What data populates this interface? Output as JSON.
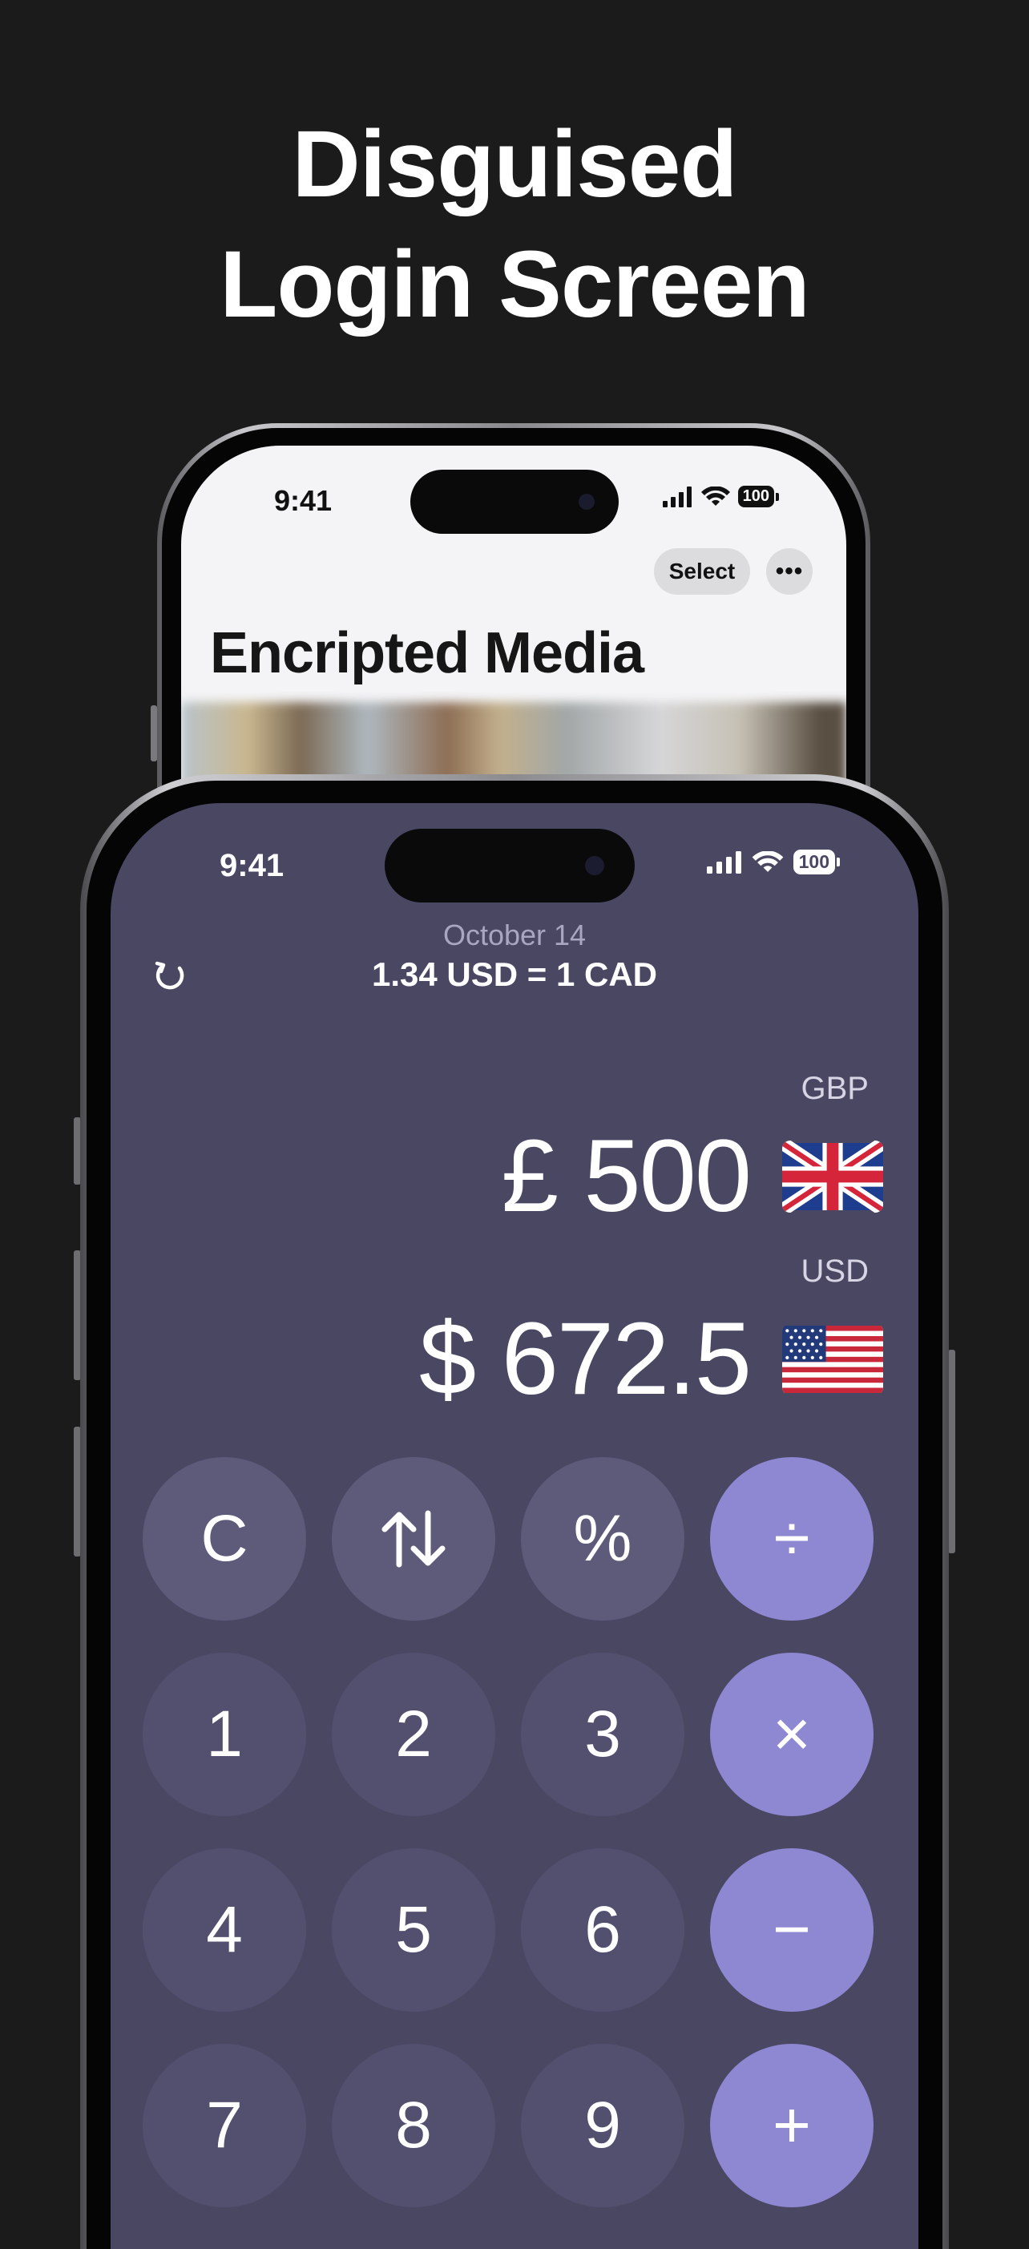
{
  "headline": {
    "line1": "Disguised",
    "line2": "Login Screen"
  },
  "back_phone": {
    "time": "9:41",
    "battery": "100",
    "select_label": "Select",
    "more_label": "•••",
    "title": "Encripted Media"
  },
  "front_phone": {
    "time": "9:41",
    "battery": "100",
    "rate": {
      "date": "October 14",
      "line": "1.34 USD = 1 CAD"
    },
    "from": {
      "code": "GBP",
      "amount": "£ 500",
      "flag": "uk-flag"
    },
    "to": {
      "code": "USD",
      "amount": "$ 672.5",
      "flag": "us-flag"
    },
    "keys": {
      "clear": "C",
      "swap_icon": "swap-arrows-icon",
      "percent": "%",
      "divide": "÷",
      "k1": "1",
      "k2": "2",
      "k3": "3",
      "multiply": "×",
      "k4": "4",
      "k5": "5",
      "k6": "6",
      "minus": "−",
      "k7": "7",
      "k8": "8",
      "k9": "9",
      "plus": "+"
    }
  },
  "colors": {
    "background": "#1b1b1c",
    "calculator_bg": "#4a4763",
    "function_key": "#5e5a7a",
    "number_key": "#534f6e",
    "operator_key": "#8e87d2"
  }
}
